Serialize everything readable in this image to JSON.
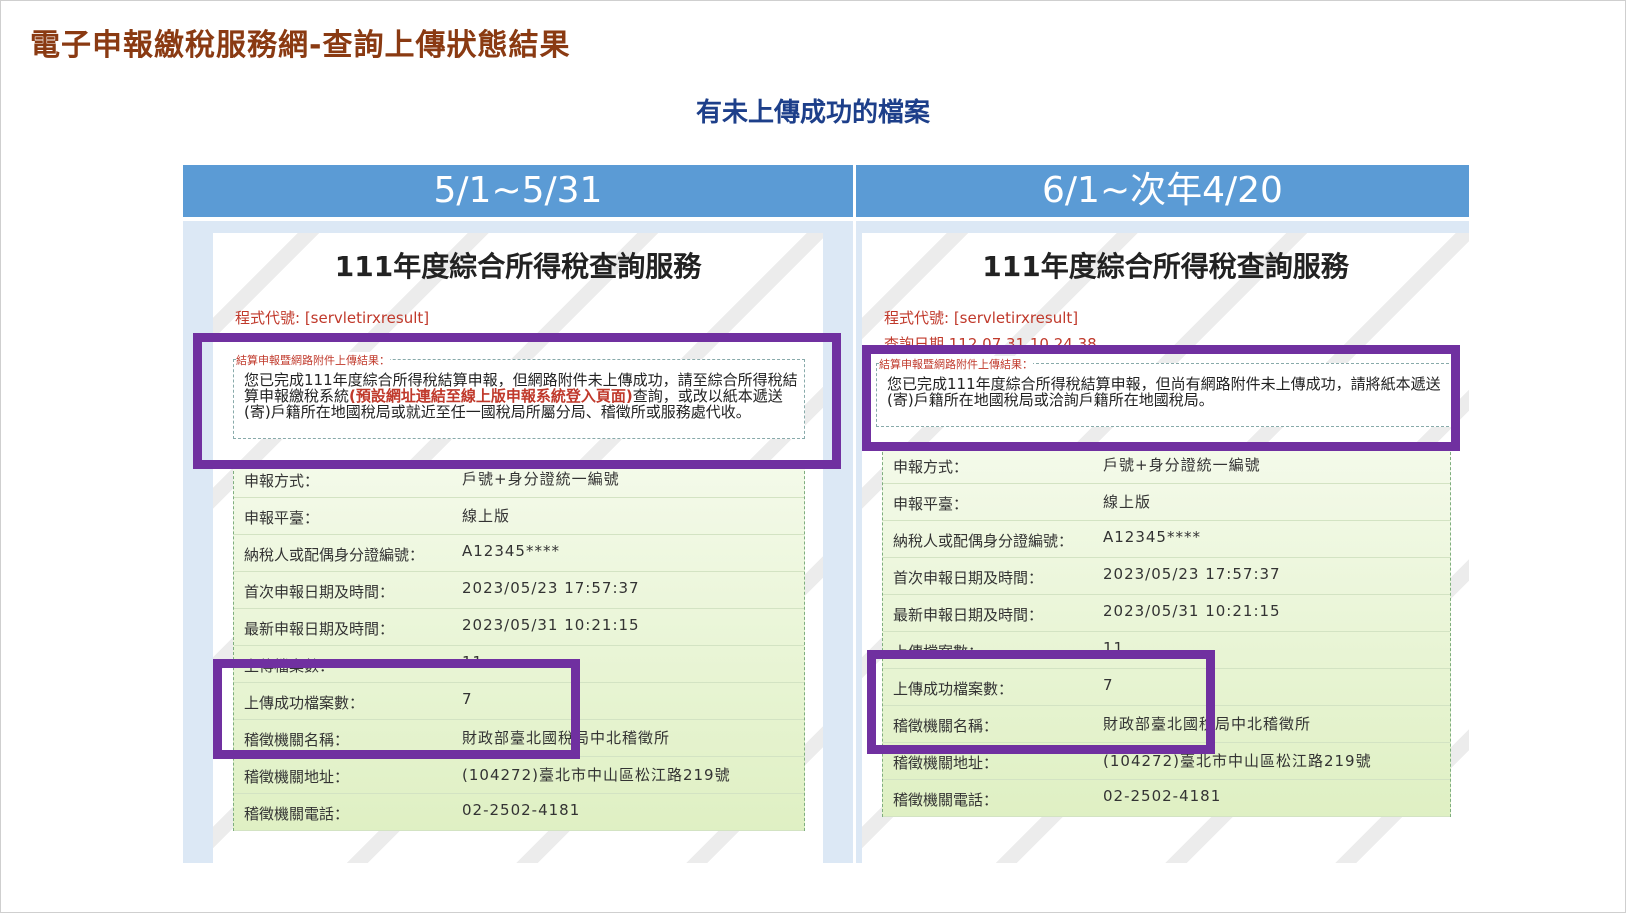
{
  "header": {
    "title": "電子申報繳稅服務網-查詢上傳狀態結果"
  },
  "subtitle": "有未上傳成功的檔案",
  "colors": {
    "title": "#8a3a12",
    "subtitle": "#1d3f8a",
    "column_header": "#5b9bd5",
    "highlight": "#7030a0",
    "notice_red": "#c0392b"
  },
  "left": {
    "header": "5/1~5/31",
    "service_title": "111年度綜合所得稅查詢服務",
    "program_code": "程式代號: [servletirxresult]",
    "notice_title": "結算申報暨網路附件上傳結果：",
    "notice_text_1": "您已完成111年度綜合所得稅結算申報，但網路附件未上傳成功，請至綜合所得稅結算申報繳稅系統",
    "notice_text_red": "(預設網址連結至線上版申報系統登入頁面)",
    "notice_text_2": "查詢，或改以紙本遞送(寄)戶籍所在地國稅局或就近至任一國稅局所屬分局、稽徵所或服務處代收。",
    "rows": [
      {
        "label": "申報方式：",
        "value": "戶號+身分證統一編號"
      },
      {
        "label": "申報平臺：",
        "value": "線上版"
      },
      {
        "label": "納稅人或配偶身分證編號：",
        "value": "A12345****"
      },
      {
        "label": "首次申報日期及時間：",
        "value": "2023/05/23 17:57:37"
      },
      {
        "label": "最新申報日期及時間：",
        "value": "2023/05/31 10:21:15"
      },
      {
        "label": "上傳檔案數：",
        "value": "11"
      },
      {
        "label": "上傳成功檔案數：",
        "value": "7"
      },
      {
        "label": "稽徵機關名稱：",
        "value": "財政部臺北國稅局中北稽徵所"
      },
      {
        "label": "稽徵機關地址：",
        "value": "(104272)臺北市中山區松江路219號"
      },
      {
        "label": "稽徵機關電話：",
        "value": "02-2502-4181"
      }
    ]
  },
  "right": {
    "header": "6/1~次年4/20",
    "service_title": "111年度綜合所得稅查詢服務",
    "program_code": "程式代號: [servletirxresult]",
    "query_date": "查詢日期 112 07 31 10 24 38",
    "notice_title": "結算申報暨網路附件上傳結果：",
    "notice_text_1": "您已完成111年度綜合所得稅結算申報，但尚有網路附件未上傳成功，請將紙本遞送(寄)戶籍所在地國稅局或洽詢戶籍所在地國稅局。",
    "rows": [
      {
        "label": "申報方式：",
        "value": "戶號+身分證統一編號"
      },
      {
        "label": "申報平臺：",
        "value": "線上版"
      },
      {
        "label": "納稅人或配偶身分證編號：",
        "value": "A12345****"
      },
      {
        "label": "首次申報日期及時間：",
        "value": "2023/05/23 17:57:37"
      },
      {
        "label": "最新申報日期及時間：",
        "value": "2023/05/31 10:21:15"
      },
      {
        "label": "上傳檔案數：",
        "value": "11"
      },
      {
        "label": "上傳成功檔案數：",
        "value": "7"
      },
      {
        "label": "稽徵機關名稱：",
        "value": "財政部臺北國稅局中北稽徵所"
      },
      {
        "label": "稽徵機關地址：",
        "value": "(104272)臺北市中山區松江路219號"
      },
      {
        "label": "稽徵機關電話：",
        "value": "02-2502-4181"
      }
    ]
  }
}
